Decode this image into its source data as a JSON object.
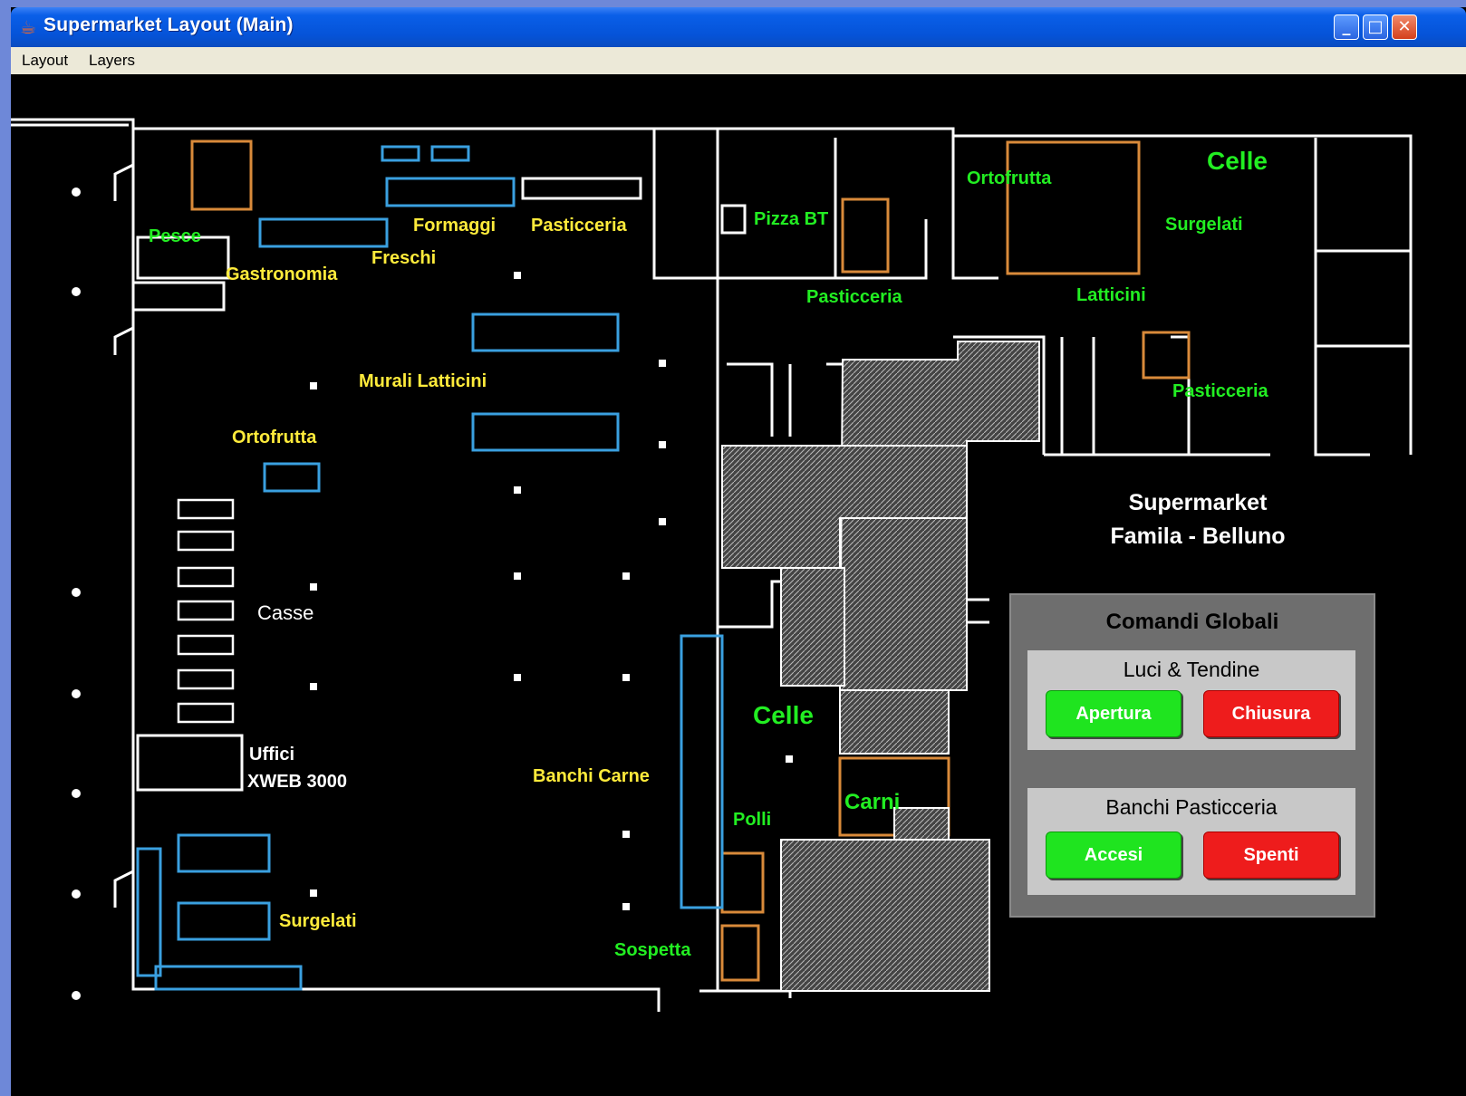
{
  "window": {
    "title": "Supermarket Layout (Main)",
    "icon": "java-cup-icon",
    "controls": {
      "minimize": "_",
      "maximize": "□",
      "close": "✕"
    }
  },
  "menu": {
    "items": [
      "Layout",
      "Layers"
    ]
  },
  "floorplan": {
    "labels_yellow": [
      "Formaggi",
      "Pasticceria",
      "Freschi",
      "Gastronomia",
      "Murali Latticini",
      "Ortofrutta",
      "Banchi Carne",
      "Surgelati"
    ],
    "labels_green": [
      "Pesce",
      "Pizza BT",
      "Ortofrutta",
      "Surgelati",
      "Pasticceria",
      "Latticini",
      "Pasticceria",
      "Carni",
      "Polli",
      "Sospetta"
    ],
    "labels_green_big": [
      "Celle",
      "Celle"
    ],
    "labels_white": [
      "Casse",
      "Uffici",
      "XWEB 3000"
    ],
    "store_name": [
      "Supermarket",
      "Famila - Belluno"
    ]
  },
  "panel": {
    "title": "Comandi Globali",
    "groups": [
      {
        "title": "Luci & Tendine",
        "on_label": "Apertura",
        "off_label": "Chiusura"
      },
      {
        "title": "Banchi Pasticceria",
        "on_label": "Accesi",
        "off_label": "Spenti"
      }
    ]
  },
  "colors": {
    "on": "#1fe41f",
    "off": "#ee1c1c",
    "label_yellow": "#ffeb3b",
    "label_green": "#22ee22",
    "titlebar": "#0553d8"
  }
}
